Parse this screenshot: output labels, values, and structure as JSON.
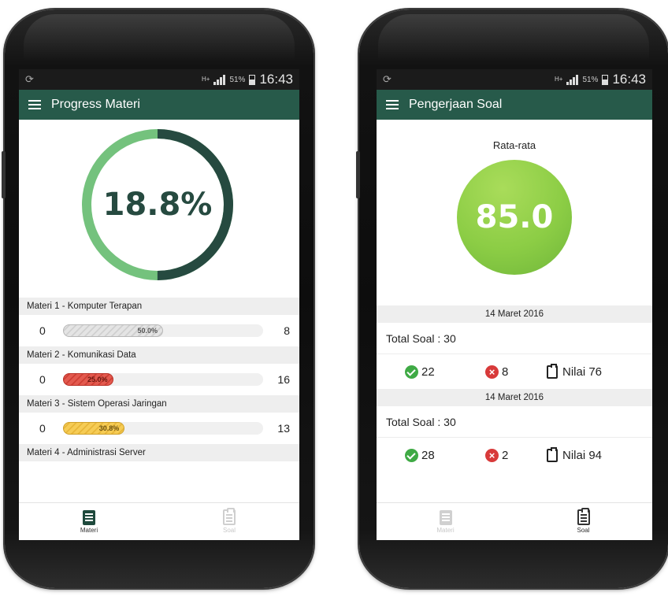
{
  "status_bar": {
    "network": "H+",
    "battery": "51%",
    "time": "16:43"
  },
  "left_screen": {
    "title": "Progress Materi",
    "overall_progress": {
      "label": "18.8%",
      "fraction": 0.188
    },
    "materi": [
      {
        "title": "Materi 1 - Komputer Terapan",
        "min": "0",
        "max": "8",
        "percent_label": "50.0%",
        "fraction": 0.5,
        "color": "#d0d0d0"
      },
      {
        "title": "Materi 2 - Komunikasi Data",
        "min": "0",
        "max": "16",
        "percent_label": "25.0%",
        "fraction": 0.25,
        "color": "#e35a4f"
      },
      {
        "title": "Materi 3 - Sistem Operasi Jaringan",
        "min": "0",
        "max": "13",
        "percent_label": "30.8%",
        "fraction": 0.308,
        "color": "#f6cc55"
      },
      {
        "title": "Materi 4 - Administrasi Server"
      }
    ],
    "nav": {
      "materi": "Materi",
      "soal": "Soal"
    }
  },
  "right_screen": {
    "title": "Pengerjaan Soal",
    "average_label": "Rata-rata",
    "average_value": "85.0",
    "attempts": [
      {
        "date": "14 Maret 2016",
        "total": "Total Soal : 30",
        "correct": "22",
        "wrong": "8",
        "score": "Nilai 76"
      },
      {
        "date": "14 Maret 2016",
        "total": "Total Soal : 30",
        "correct": "28",
        "wrong": "2",
        "score": "Nilai 94"
      }
    ],
    "nav": {
      "materi": "Materi",
      "soal": "Soal"
    }
  },
  "colors": {
    "app_bar": "#275a4a",
    "ring_dark": "#264a40",
    "ring_light": "#74c27d",
    "average_green": "#8ccd45",
    "correct": "#3faa45",
    "wrong": "#d83a3a"
  }
}
